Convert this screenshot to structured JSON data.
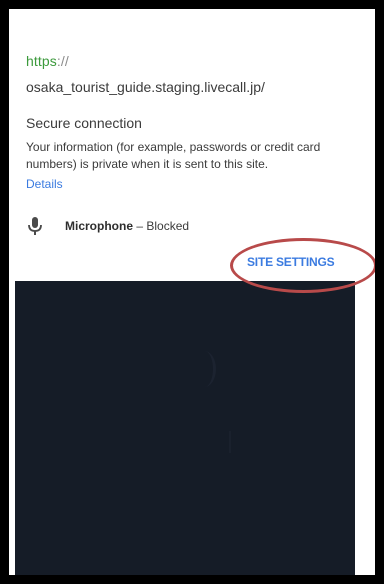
{
  "popup": {
    "url_scheme": "https",
    "url_separator": "://",
    "url_host": "osaka_tourist_guide.staging.livecall.jp/",
    "secure_title": "Secure connection",
    "secure_description": "Your information (for example, passwords or credit card numbers) is private when it is sent to this site.",
    "details_link": "Details",
    "permission": {
      "icon": "microphone-icon",
      "name": "Microphone",
      "separator": " – ",
      "status": "Blocked"
    },
    "site_settings_button": "SITE SETTINGS"
  },
  "colors": {
    "secure_scheme": "#3c9a3c",
    "link": "#3b7be0",
    "highlight": "#b84a4a",
    "video_background": "#151c27"
  }
}
